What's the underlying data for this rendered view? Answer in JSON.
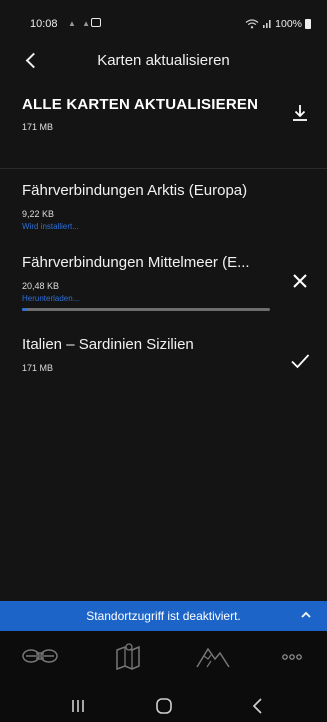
{
  "status_bar": {
    "time": "10:08",
    "mini_icons": "▲ ▲",
    "signal": "≋.│",
    "battery_text": "100%"
  },
  "header": {
    "title": "Karten aktualisieren"
  },
  "all_maps": {
    "title": "ALLE KARTEN AKTUALISIEREN",
    "size": "171 MB"
  },
  "maps": [
    {
      "name": "Fährverbindungen Arktis (Europa)",
      "size": "9,22 KB",
      "status": "Wird installiert..."
    },
    {
      "name": "Fährverbindungen Mittelmeer (E...",
      "size": "20,48 KB",
      "status": "Herunterladen...",
      "progress": 0.02
    },
    {
      "name": "Italien – Sardinien Sizilien",
      "size": "171 MB",
      "status": ""
    }
  ],
  "banner": {
    "text": "Standortzugriff ist deaktiviert."
  },
  "bottom_nav": {
    "items": [
      "car-icon",
      "map-icon",
      "mountain-icon",
      "more-icon"
    ]
  },
  "colors": {
    "background": "#141414",
    "accent_blue": "#1c64c8",
    "status_blue": "#2f6fd6"
  }
}
